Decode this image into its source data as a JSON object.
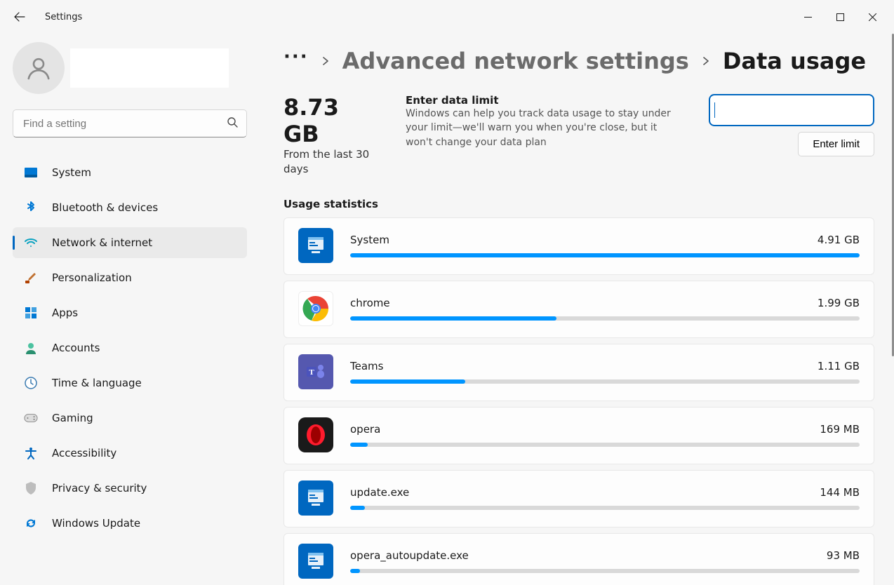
{
  "app_title": "Settings",
  "search_placeholder": "Find a setting",
  "nav": [
    {
      "label": "System",
      "icon": "system"
    },
    {
      "label": "Bluetooth & devices",
      "icon": "bluetooth"
    },
    {
      "label": "Network & internet",
      "icon": "wifi"
    },
    {
      "label": "Personalization",
      "icon": "brush"
    },
    {
      "label": "Apps",
      "icon": "apps"
    },
    {
      "label": "Accounts",
      "icon": "accounts"
    },
    {
      "label": "Time & language",
      "icon": "time"
    },
    {
      "label": "Gaming",
      "icon": "gaming"
    },
    {
      "label": "Accessibility",
      "icon": "accessibility"
    },
    {
      "label": "Privacy & security",
      "icon": "privacy"
    },
    {
      "label": "Windows Update",
      "icon": "update"
    }
  ],
  "active_nav_index": 2,
  "breadcrumb": {
    "prev": "Advanced network settings",
    "current": "Data usage"
  },
  "total": {
    "value": "8.73 GB",
    "sub": "From the last 30 days"
  },
  "limit": {
    "title": "Enter data limit",
    "body": "Windows can help you track data usage to stay under your limit—we'll warn you when you're close, but it won't change your data plan",
    "button": "Enter limit"
  },
  "section_title": "Usage statistics",
  "usage": [
    {
      "name": "System",
      "size": "4.91 GB",
      "pct": 100,
      "icon": "sys"
    },
    {
      "name": "chrome",
      "size": "1.99 GB",
      "pct": 40.5,
      "icon": "chrome"
    },
    {
      "name": "Teams",
      "size": "1.11 GB",
      "pct": 22.6,
      "icon": "teams"
    },
    {
      "name": "opera",
      "size": "169 MB",
      "pct": 3.4,
      "icon": "opera"
    },
    {
      "name": "update.exe",
      "size": "144 MB",
      "pct": 2.9,
      "icon": "sys"
    },
    {
      "name": "opera_autoupdate.exe",
      "size": "93 MB",
      "pct": 1.9,
      "icon": "sys"
    }
  ]
}
